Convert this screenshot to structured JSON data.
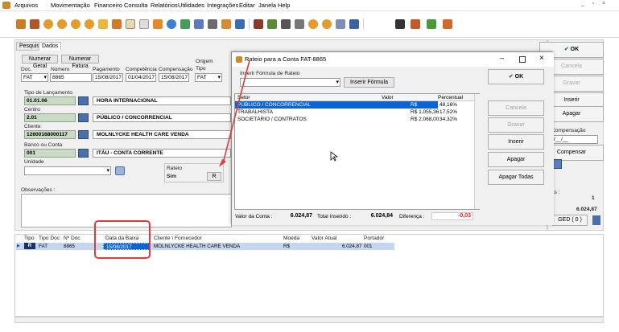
{
  "menu": [
    "Arquivos",
    "Movimentação",
    "Financeiro",
    "Consulta",
    "Relatórios",
    "Utilidades",
    "Integrações",
    "Editar",
    "Janela",
    "Help"
  ],
  "window_controls": {
    "minimize": "_",
    "restore": "▫",
    "close": "×"
  },
  "toolbar_icons": [
    "new-icon",
    "user-icon",
    "clock-icon",
    "clock-add-icon",
    "clock-edit-icon",
    "clock-check-icon",
    "folder-icon",
    "bag-icon",
    "document-icon",
    "copy-icon",
    "web-icon",
    "sync-icon",
    "window-icon",
    "check-icon",
    "print-icon",
    "users-icon",
    "arrow-icon",
    "flow-icon",
    "camera-icon",
    "clock-blue-icon",
    "clock-red-icon",
    "image-icon",
    "display-icon",
    "tools-icon",
    "puzzle-icon",
    "box-icon",
    "exit-icon"
  ],
  "tabs": {
    "pesquisa": "Pesquisa",
    "dados": "Dados"
  },
  "subtabs": {
    "numero_geral": "Numerar Geral",
    "numero_fatura": "Numerar Fatura"
  },
  "form": {
    "doc_label": "Doc.",
    "doc_value": "FAT",
    "numero_label": "Número",
    "numero_value": "8865",
    "pagamento_label": "Pagamento",
    "pagamento_value": "15/08/2017",
    "competencia_label": "Competência",
    "competencia_value": "01/04/2017",
    "compensacao_label": "Compensação",
    "compensacao_value": "15/08/2017",
    "origem_label": "Origem",
    "tipo_label": "Tipo",
    "tipo_value": "FAT",
    "tipo_lanc_label": "Tipo de Lançamento",
    "tipo_lanc_code": "01.01.06",
    "tipo_lanc_desc": "HORA INTERNACIONAL",
    "centro_label": "Centro",
    "centro_code": "2.01",
    "centro_desc": "PÚBLICO / CONCORRENCIAL",
    "cliente_label": "Cliente",
    "cliente_code": "12600168000117",
    "cliente_desc": "MOLNLYCKE HEALTH CARE VENDA",
    "banco_label": "Banco ou Conta",
    "banco_code": "001",
    "banco_desc": "ITÁU - CONTA CORRENTE",
    "unidade_label": "Unidade",
    "rateio_label": "Rateio",
    "rateio_value": "Sim",
    "rateio_btn": "R",
    "obs_label": "Observações :"
  },
  "right_panel": {
    "ok": "OK",
    "cancela": "Cancela",
    "gravar": "Gravar",
    "inserir": "Inserir",
    "apagar": "Apagar",
    "compensacao_label": "Compensação",
    "compensacao_value": "/__/__",
    "compensar": "Compensar",
    "summary_label": "as :",
    "summary_count": "1",
    "summary_total": "6.024,87",
    "ged": "GED ( 0 )"
  },
  "grid": {
    "headers": [
      "Tipo",
      "Tipo Doc",
      "Nº Doc",
      "Data da Baixa",
      "Cliente \\ Fornecedor",
      "Moeda",
      "Valor Atual",
      "Portador"
    ],
    "rows": [
      [
        "R",
        "FAT",
        "8865",
        "15/08/2017",
        "MOLNLYCKE HEALTH CARE VENDA",
        "R$",
        "6.024,87",
        "001"
      ]
    ]
  },
  "dialog": {
    "title": "Rateio para a Conta FAT-8865",
    "formula_label": "Inserir Fórmula de Rateio",
    "formula_btn": "Inserir Fórmula",
    "headers": [
      "Setor",
      "Valor",
      "Percentual"
    ],
    "rows": [
      [
        "PÚBLICO / CONCORRENCIAL",
        "R$ 2.901,47",
        "48,16%"
      ],
      [
        "TRABALHISTA",
        "R$ 1.055,36",
        "17,52%"
      ],
      [
        "SOCIETÁRIO / CONTRATOS",
        "R$ 2.068,00",
        "34,32%"
      ]
    ],
    "buttons": {
      "ok": "OK",
      "cancela": "Cancela",
      "gravar": "Gravar",
      "inserir": "Inserir",
      "apagar": "Apagar",
      "apagar_todas": "Apagar Todas"
    },
    "valor_conta_label": "Valor da Conta :",
    "valor_conta": "6.024,87",
    "total_inserido_label": "Total Inserido :",
    "total_inserido": "6.024,84",
    "diferenca_label": "Diferença :",
    "diferenca": "-0,03"
  },
  "colors": {
    "accent": "#0a64d6",
    "selection": "#0a64d6",
    "green_field": "#c7dcc0",
    "highlight_red": "#e03b3b",
    "negative": "#e02020"
  }
}
